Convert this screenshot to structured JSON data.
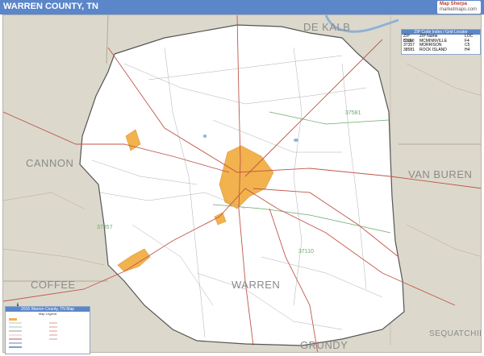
{
  "header": {
    "title": "WARREN COUNTY, TN",
    "brand_top": "Map Sherpa",
    "brand_sub": "marketmaps.com"
  },
  "counties": {
    "dekalb": "DE KALB",
    "cannon": "CANNON",
    "van_buren": "VAN BUREN",
    "coffee": "COFFEE",
    "warren": "WARREN",
    "grundy": "GRUNDY",
    "sequatchie": "SEQUATCHIE"
  },
  "zip_labels": [
    "37581",
    "37357",
    "37110"
  ],
  "zip_locator": {
    "title": "ZIP Code Index / Grid Locator",
    "headers": [
      "ZIP Code",
      "ZIP Name",
      "LOC"
    ],
    "rows": [
      [
        "37110",
        "MCMINNVILLE",
        "F4"
      ],
      [
        "37357",
        "MORRISON",
        "C5"
      ],
      [
        "38581",
        "ROCK ISLAND",
        "H4"
      ]
    ]
  },
  "legend": {
    "title": "2016 Warren County, TN Map",
    "subtitle": "Map Legend"
  },
  "colors": {
    "title_bar": "#5b86c9",
    "county_fill": "#ffffff",
    "outside_fill": "#dcd9cc",
    "city_fill": "#f2b24e",
    "road_major": "#c0564a",
    "road_minor": "#9a9a9a",
    "water": "#8fb1d6",
    "zip_boundary": "#6aa86a"
  }
}
